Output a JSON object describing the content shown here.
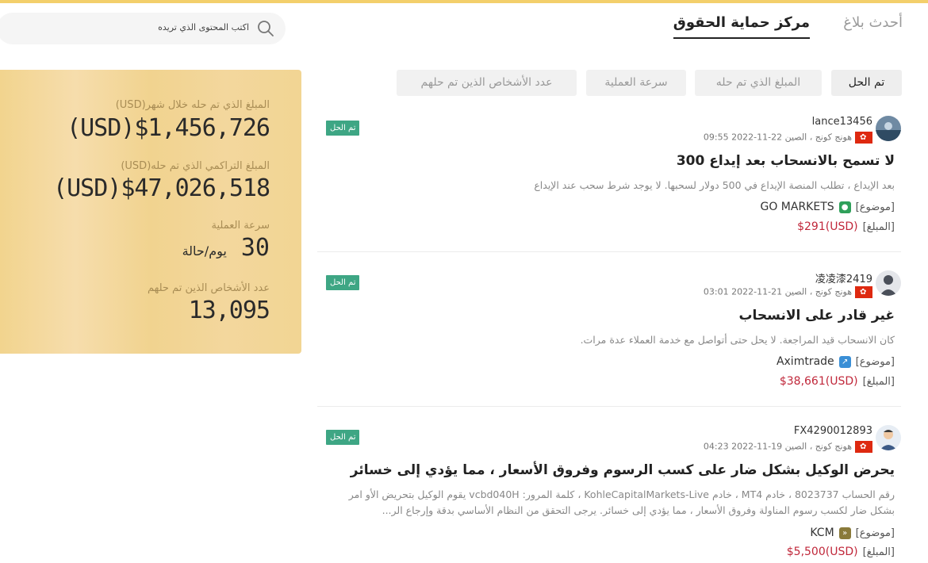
{
  "tabs": [
    {
      "label": "مركز حماية الحقوق",
      "active": true
    },
    {
      "label": "أحدث بلاغ",
      "active": false
    }
  ],
  "filters": [
    {
      "label": "تم الحل",
      "active": true
    },
    {
      "label": "المبلغ الذي تم حله",
      "active": false
    },
    {
      "label": "سرعة العملية",
      "active": false
    },
    {
      "label": "عدد الأشخاص الذين تم حلهم",
      "active": false
    }
  ],
  "search": {
    "placeholder": "اكتب المحتوى الذي تريده"
  },
  "stats": {
    "monthly_label": "المبلغ الذي تم حله خلال شهر(USD)",
    "monthly_value": "(USD)$1,456,726",
    "cumulative_label": "المبلغ التراكمي الذي تم حله(USD)",
    "cumulative_value": "(USD)$47,026,518",
    "speed_label": "سرعة العملية",
    "speed_value": "30",
    "speed_unit": "يوم/حالة",
    "people_label": "عدد الأشخاص الذين تم حلهم",
    "people_value": "13,095"
  },
  "labels": {
    "topic": "[موضوع]",
    "amount": "[المبلغ]"
  },
  "posts": [
    {
      "username": "lance13456",
      "location_time": "هونج كونج ، الصين 22-11-2022 09:55",
      "badge": "تم الحل",
      "title": "لا تسمح بالانسحاب بعد إيداع 300",
      "desc": "بعد الإيداع ، تطلب المنصة الإيداع في 500 دولار لسحبها. لا يوجد شرط سحب عند الإيداع",
      "broker": "GO MARKETS",
      "broker_icon": "go-markets-icon",
      "broker_color": "#2fa05a",
      "amount": "(USD)$291"
    },
    {
      "username": "凌凌漆2419",
      "location_time": "هونج كونج ، الصين 21-11-2022 03:01",
      "badge": "تم الحل",
      "title": "غير قادر على الانسحاب",
      "desc": "كان الانسحاب قيد المراجعة. لا يحل حتى أتواصل مع خدمة العملاء عدة مرات.",
      "broker": "Aximtrade",
      "broker_icon": "aximtrade-icon",
      "broker_color": "#3a8fd6",
      "amount": "(USD)$38,661"
    },
    {
      "username": "FX4290012893",
      "location_time": "هونج كونج ، الصين 19-11-2022 04:23",
      "badge": "تم الحل",
      "title": "يحرض الوكيل بشكل ضار على كسب الرسوم وفروق الأسعار ، مما يؤدي إلى خسائر",
      "desc": "رقم الحساب 8023737 ، خادم MT4 ، خادم KohleCapitalMarkets-Live ، كلمة المرور: vcbd040H يقوم الوكيل بتحريض الأو امر بشكل ضار لكسب رسوم المناولة وفروق الأسعار ، مما يؤدي إلى خسائر. يرجى التحقق من النظام الأساسي بدقة وإرجاع الر...",
      "broker": "KCM",
      "broker_icon": "kcm-icon",
      "broker_color": "#8a7a3a",
      "amount": "(USD)$5,500"
    }
  ]
}
